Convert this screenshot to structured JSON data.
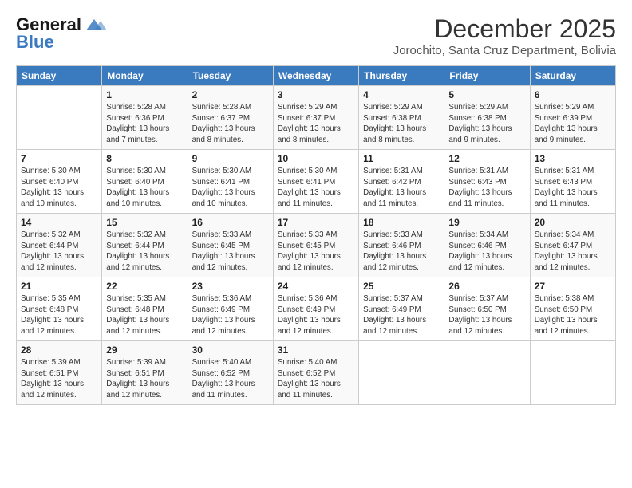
{
  "logo": {
    "line1": "General",
    "line2": "Blue"
  },
  "title": "December 2025",
  "location": "Jorochito, Santa Cruz Department, Bolivia",
  "days_header": [
    "Sunday",
    "Monday",
    "Tuesday",
    "Wednesday",
    "Thursday",
    "Friday",
    "Saturday"
  ],
  "weeks": [
    [
      {
        "day": "",
        "info": ""
      },
      {
        "day": "1",
        "info": "Sunrise: 5:28 AM\nSunset: 6:36 PM\nDaylight: 13 hours\nand 7 minutes."
      },
      {
        "day": "2",
        "info": "Sunrise: 5:28 AM\nSunset: 6:37 PM\nDaylight: 13 hours\nand 8 minutes."
      },
      {
        "day": "3",
        "info": "Sunrise: 5:29 AM\nSunset: 6:37 PM\nDaylight: 13 hours\nand 8 minutes."
      },
      {
        "day": "4",
        "info": "Sunrise: 5:29 AM\nSunset: 6:38 PM\nDaylight: 13 hours\nand 8 minutes."
      },
      {
        "day": "5",
        "info": "Sunrise: 5:29 AM\nSunset: 6:38 PM\nDaylight: 13 hours\nand 9 minutes."
      },
      {
        "day": "6",
        "info": "Sunrise: 5:29 AM\nSunset: 6:39 PM\nDaylight: 13 hours\nand 9 minutes."
      }
    ],
    [
      {
        "day": "7",
        "info": "Sunrise: 5:30 AM\nSunset: 6:40 PM\nDaylight: 13 hours\nand 10 minutes."
      },
      {
        "day": "8",
        "info": "Sunrise: 5:30 AM\nSunset: 6:40 PM\nDaylight: 13 hours\nand 10 minutes."
      },
      {
        "day": "9",
        "info": "Sunrise: 5:30 AM\nSunset: 6:41 PM\nDaylight: 13 hours\nand 10 minutes."
      },
      {
        "day": "10",
        "info": "Sunrise: 5:30 AM\nSunset: 6:41 PM\nDaylight: 13 hours\nand 11 minutes."
      },
      {
        "day": "11",
        "info": "Sunrise: 5:31 AM\nSunset: 6:42 PM\nDaylight: 13 hours\nand 11 minutes."
      },
      {
        "day": "12",
        "info": "Sunrise: 5:31 AM\nSunset: 6:43 PM\nDaylight: 13 hours\nand 11 minutes."
      },
      {
        "day": "13",
        "info": "Sunrise: 5:31 AM\nSunset: 6:43 PM\nDaylight: 13 hours\nand 11 minutes."
      }
    ],
    [
      {
        "day": "14",
        "info": "Sunrise: 5:32 AM\nSunset: 6:44 PM\nDaylight: 13 hours\nand 12 minutes."
      },
      {
        "day": "15",
        "info": "Sunrise: 5:32 AM\nSunset: 6:44 PM\nDaylight: 13 hours\nand 12 minutes."
      },
      {
        "day": "16",
        "info": "Sunrise: 5:33 AM\nSunset: 6:45 PM\nDaylight: 13 hours\nand 12 minutes."
      },
      {
        "day": "17",
        "info": "Sunrise: 5:33 AM\nSunset: 6:45 PM\nDaylight: 13 hours\nand 12 minutes."
      },
      {
        "day": "18",
        "info": "Sunrise: 5:33 AM\nSunset: 6:46 PM\nDaylight: 13 hours\nand 12 minutes."
      },
      {
        "day": "19",
        "info": "Sunrise: 5:34 AM\nSunset: 6:46 PM\nDaylight: 13 hours\nand 12 minutes."
      },
      {
        "day": "20",
        "info": "Sunrise: 5:34 AM\nSunset: 6:47 PM\nDaylight: 13 hours\nand 12 minutes."
      }
    ],
    [
      {
        "day": "21",
        "info": "Sunrise: 5:35 AM\nSunset: 6:48 PM\nDaylight: 13 hours\nand 12 minutes."
      },
      {
        "day": "22",
        "info": "Sunrise: 5:35 AM\nSunset: 6:48 PM\nDaylight: 13 hours\nand 12 minutes."
      },
      {
        "day": "23",
        "info": "Sunrise: 5:36 AM\nSunset: 6:49 PM\nDaylight: 13 hours\nand 12 minutes."
      },
      {
        "day": "24",
        "info": "Sunrise: 5:36 AM\nSunset: 6:49 PM\nDaylight: 13 hours\nand 12 minutes."
      },
      {
        "day": "25",
        "info": "Sunrise: 5:37 AM\nSunset: 6:49 PM\nDaylight: 13 hours\nand 12 minutes."
      },
      {
        "day": "26",
        "info": "Sunrise: 5:37 AM\nSunset: 6:50 PM\nDaylight: 13 hours\nand 12 minutes."
      },
      {
        "day": "27",
        "info": "Sunrise: 5:38 AM\nSunset: 6:50 PM\nDaylight: 13 hours\nand 12 minutes."
      }
    ],
    [
      {
        "day": "28",
        "info": "Sunrise: 5:39 AM\nSunset: 6:51 PM\nDaylight: 13 hours\nand 12 minutes."
      },
      {
        "day": "29",
        "info": "Sunrise: 5:39 AM\nSunset: 6:51 PM\nDaylight: 13 hours\nand 12 minutes."
      },
      {
        "day": "30",
        "info": "Sunrise: 5:40 AM\nSunset: 6:52 PM\nDaylight: 13 hours\nand 11 minutes."
      },
      {
        "day": "31",
        "info": "Sunrise: 5:40 AM\nSunset: 6:52 PM\nDaylight: 13 hours\nand 11 minutes."
      },
      {
        "day": "",
        "info": ""
      },
      {
        "day": "",
        "info": ""
      },
      {
        "day": "",
        "info": ""
      }
    ]
  ]
}
